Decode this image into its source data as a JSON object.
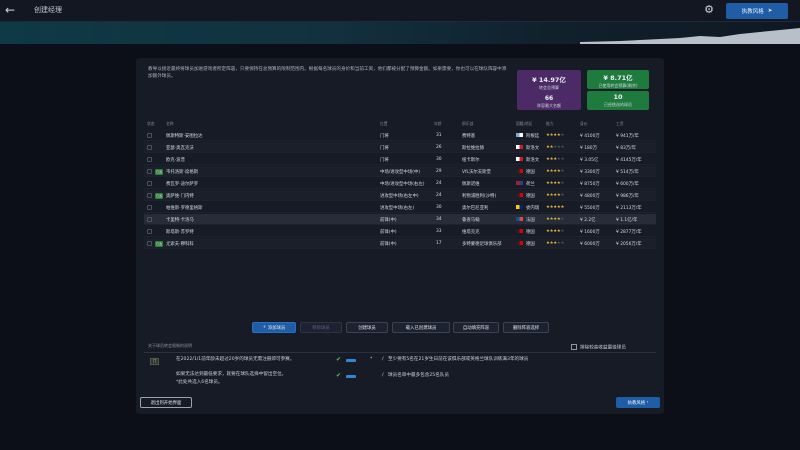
{
  "topbar": {
    "title": "创建经理",
    "continue_label": "执教风格",
    "back_icon": "back-arrow-icon",
    "gear_icon": "gear-icon"
  },
  "description": "教导以接近最终将球员加进游戏者所定阵容，只要保持在总预算的限制范围内。根据每名球员的身价和当前工资，他们都被分配了预算金额。如果需要，你也可以在球队阵容中添加额外球员。",
  "stats": {
    "transfer_budget": {
      "value": "¥ 14.97亿",
      "label": "转会总预算"
    },
    "spent": {
      "value": "¥ 8.71亿",
      "label": "已使用转会预算(剩余)"
    },
    "players_count": {
      "value": "66",
      "label": "阵容最大名额"
    },
    "selected_count": {
      "value": "10",
      "label": "已经挑选的球员"
    }
  },
  "table": {
    "headers": [
      "状态",
      "名称",
      "位置",
      "年龄",
      "俱乐部",
      "国籍/地区",
      "能力",
      "身价",
      "工资"
    ],
    "rows": [
      {
        "status": "",
        "name": "佩斯特斯·安图拉达",
        "pos": "门将",
        "age": "31",
        "club": "费特基",
        "nat": "阿根廷",
        "stars": 4,
        "value": "¥ 4100万",
        "wage": "¥ 941万/年"
      },
      {
        "status": "",
        "name": "亚瑟·奥瓦克沃",
        "pos": "门将",
        "age": "26",
        "club": "斯拉维拉赫",
        "nat": "斯洛文",
        "stars": 2,
        "value": "¥ 180万",
        "wage": "¥ 83万/年"
      },
      {
        "status": "",
        "name": "欧克·波普",
        "pos": "门将",
        "age": "30",
        "club": "纽卡斯尔",
        "nat": "斯洛文",
        "stars": 3,
        "value": "¥ 3.05亿",
        "wage": "¥ 4145万/年"
      },
      {
        "status": "已选",
        "name": "韦托洛斯·席格斯",
        "pos": "中场/进攻型中场(中)",
        "age": "29",
        "club": "VfL沃尔夫斯堡",
        "nat": "德国",
        "stars": 4,
        "value": "¥ 3300万",
        "wage": "¥ 514万/年"
      },
      {
        "status": "",
        "name": "费瓦罗·迪尔萨罗",
        "pos": "中场/进攻型中场(右左)",
        "age": "24",
        "club": "佩斯诺维",
        "nat": "荷兰",
        "stars": 4,
        "value": "¥ 8750万",
        "wage": "¥ 600万/年"
      },
      {
        "status": "已选",
        "name": "奥萨维·门内特",
        "pos": "进攻型中场(右左中)",
        "age": "24",
        "club": "利物浦胜利(沙特)",
        "nat": "德国",
        "stars": 4,
        "value": "¥ 4800万",
        "wage": "¥ 986万/年"
      },
      {
        "status": "",
        "name": "帕维斯·罗德里格斯",
        "pos": "进攻型中场(右左)",
        "age": "30",
        "club": "奥尔巴尼亚利",
        "nat": "委内瑞",
        "stars": 5,
        "value": "¥ 5500万",
        "wage": "¥ 2113万/年"
      },
      {
        "status": "",
        "name": "卡里特·卡洛马",
        "pos": "前锋(中)",
        "age": "34",
        "club": "鲁查马翰",
        "nat": "法国",
        "stars": 4,
        "value": "¥ 2.2亿",
        "wage": "¥ 1.1亿/年"
      },
      {
        "status": "",
        "name": "斯塔斯·苏罗特",
        "pos": "前锋(中)",
        "age": "33",
        "club": "维塔克克",
        "nat": "德国",
        "stars": 4,
        "value": "¥ 1600万",
        "wage": "¥ 2877万/年"
      },
      {
        "status": "已选",
        "name": "尤索夫·穆科科",
        "pos": "前锋(中)",
        "age": "17",
        "club": "多特蒙德足球俱乐部",
        "nat": "德国",
        "stars": 3,
        "value": "¥ 6000万",
        "wage": "¥ 2056万/年"
      }
    ]
  },
  "actions": {
    "add": "添加球员",
    "remove": "移除球员",
    "create": "创建球员",
    "load": "载入已创建球员",
    "auto": "自动填充阵容",
    "reset": "删除阵容选择"
  },
  "rules": {
    "section_title": "关于球员转会限制的说明",
    "exclude_label": "排除较高收益最佳球员",
    "badge": "门",
    "line1": "在2022/1/1前年龄未超过20岁的球员无需注册即可参赛。",
    "line2": "如果无法达到最低要求，就要在球队选择中留出空位。",
    "line3": "*此处共选入6名球员。",
    "req1": "至少要有5名在21岁生日前在该俱乐部或英格兰球队训练满3年的球员",
    "req2": "球员名单中最多包含25名队员"
  },
  "footer": {
    "exit": "退出到开始界面",
    "continue": "执教风格"
  },
  "colors": {
    "accent": "#1f5ea6",
    "green": "#1f7a3e",
    "purple": "#4b2a66"
  }
}
